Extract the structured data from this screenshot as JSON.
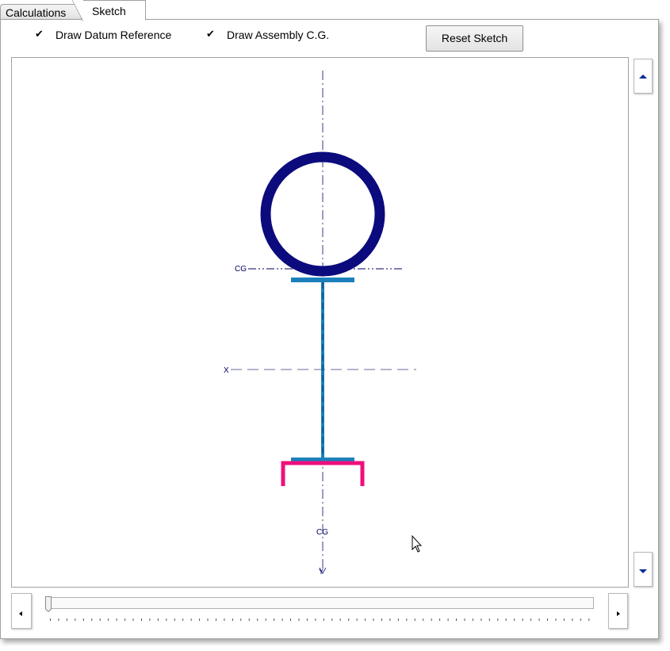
{
  "tabs": [
    {
      "label": "Calculations",
      "active": false
    },
    {
      "label": "Sketch",
      "active": true
    }
  ],
  "options": {
    "draw_datum_reference": {
      "label": "Draw Datum Reference",
      "checked": true
    },
    "draw_assembly_cg": {
      "label": "Draw Assembly C.G.",
      "checked": true
    }
  },
  "toolbar": {
    "reset_label": "Reset Sketch"
  },
  "sketch": {
    "labels": {
      "cg_top": "CG",
      "x_axis": "X",
      "cg_bottom": "CG",
      "y_axis": "Y"
    },
    "colors": {
      "pipe": "#0b0b7e",
      "beam": "#1b80ba",
      "channel": "#ef0f7d",
      "datum": "#3a3a8a"
    }
  },
  "slider": {
    "value": 0
  }
}
